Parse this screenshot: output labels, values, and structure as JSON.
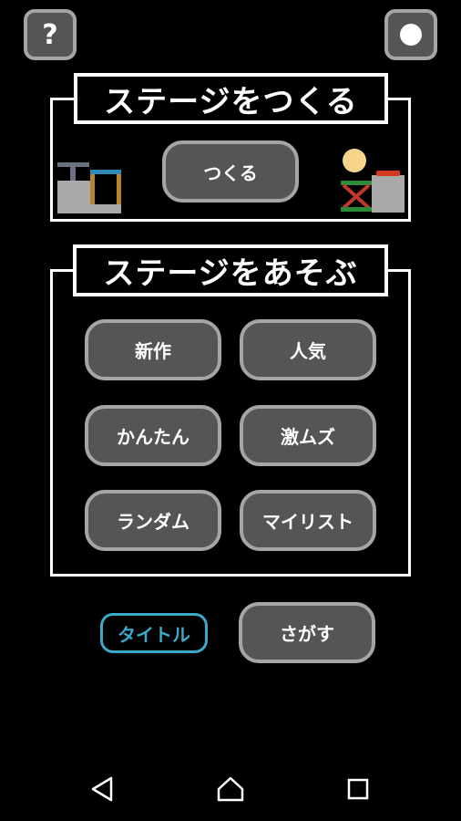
{
  "header": {
    "help_label": "?",
    "help_icon": "question-mark-icon",
    "record_icon": "record-dot-icon"
  },
  "make_section": {
    "title": "ステージをつくる",
    "create_button": "つくる"
  },
  "play_section": {
    "title": "ステージをあそぶ",
    "buttons": [
      "新作",
      "人気",
      "かんたん",
      "激ムズ",
      "ランダム",
      "マイリスト"
    ]
  },
  "footer": {
    "title_button": "タイトル",
    "search_button": "さがす"
  },
  "navbar": {
    "icons": [
      "back-triangle-icon",
      "home-icon",
      "recent-apps-icon"
    ]
  },
  "colors": {
    "background": "#000000",
    "button_fill": "#555555",
    "button_border": "#a5a5a5",
    "accent_cyan": "#3ca9c8"
  }
}
